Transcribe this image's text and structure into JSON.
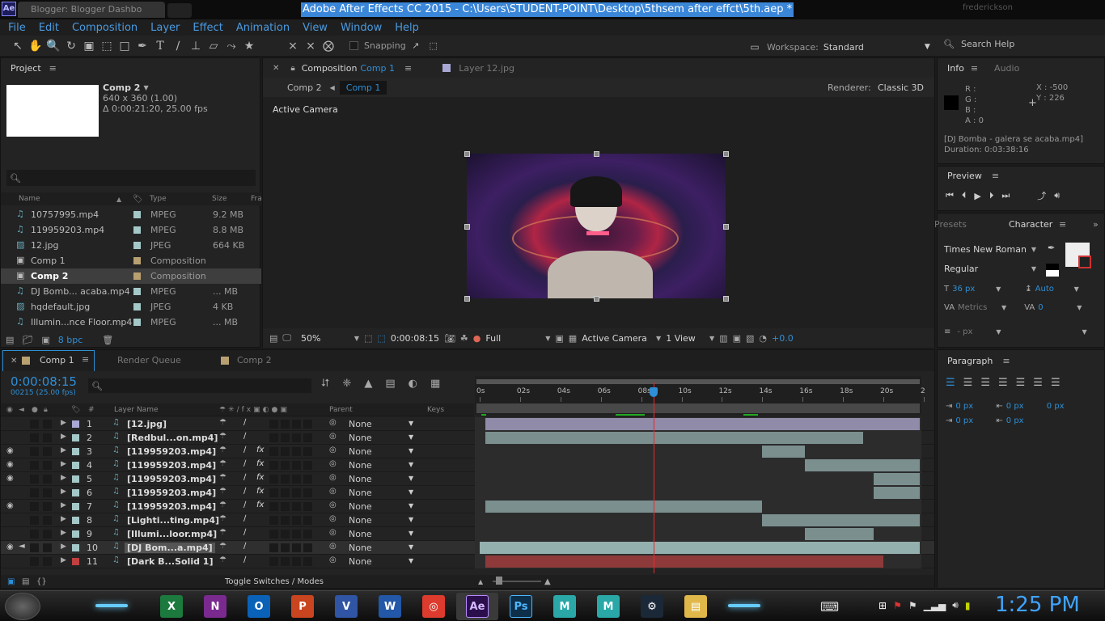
{
  "window": {
    "title": "Adobe After Effects CC 2015 - C:\\Users\\STUDENT-POINT\\Desktop\\5thsem after effct\\5th.aep *",
    "browser_tab": "Blogger: Blogger Dashbo",
    "browser_user": "frederickson",
    "app_badge": "Ae"
  },
  "menu": [
    "File",
    "Edit",
    "Composition",
    "Layer",
    "Effect",
    "Animation",
    "View",
    "Window",
    "Help"
  ],
  "toolbar": {
    "snapping_label": "Snapping",
    "workspace_label": "Workspace:",
    "workspace_value": "Standard",
    "search_help": "Search Help"
  },
  "project": {
    "title": "Project",
    "comp_name": "Comp 2",
    "comp_size": "640 x 360 (1.00)",
    "comp_duration": "Δ 0:00:21:20, 25.00 fps",
    "columns": {
      "name": "Name",
      "type": "Type",
      "size": "Size",
      "fr": "Fra"
    },
    "items": [
      {
        "name": "10757995.mp4",
        "type": "MPEG",
        "size": "9.2 MB",
        "color": "#a4c8c8",
        "kind": "video"
      },
      {
        "name": "119959203.mp4",
        "type": "MPEG",
        "size": "8.8 MB",
        "color": "#a4c8c8",
        "kind": "video"
      },
      {
        "name": "12.jpg",
        "type": "JPEG",
        "size": "664 KB",
        "color": "#a4c8c8",
        "kind": "image"
      },
      {
        "name": "Comp 1",
        "type": "Composition",
        "size": "",
        "color": "#b8a070",
        "kind": "comp"
      },
      {
        "name": "Comp 2",
        "type": "Composition",
        "size": "",
        "color": "#b8a070",
        "kind": "comp"
      },
      {
        "name": "DJ Bomb... acaba.mp4",
        "type": "MPEG",
        "size": "... MB",
        "color": "#a4c8c8",
        "kind": "video"
      },
      {
        "name": "hqdefault.jpg",
        "type": "JPEG",
        "size": "4 KB",
        "color": "#a4c8c8",
        "kind": "image"
      },
      {
        "name": "Illumin...nce Floor.mp4",
        "type": "MPEG",
        "size": "... MB",
        "color": "#a4c8c8",
        "kind": "video"
      }
    ],
    "bpc": "8 bpc"
  },
  "comp_panel": {
    "tab_label": "Composition",
    "tab_comp": "Comp 1",
    "tab2_label": "Layer 12.jpg",
    "breadcrumb1": "Comp 2",
    "breadcrumb2": "Comp 1",
    "renderer_label": "Renderer:",
    "renderer_value": "Classic 3D",
    "view_label": "Active Camera",
    "footer": {
      "zoom": "50%",
      "timecode": "0:00:08:15",
      "resolution": "Full",
      "camera": "Active Camera",
      "views": "1 View",
      "exposure": "+0.0"
    }
  },
  "info": {
    "tab1": "Info",
    "tab2": "Audio",
    "r": "R :",
    "g": "G :",
    "b": "B :",
    "a": "A : 0",
    "x": "X : -500",
    "y": "Y : 226",
    "file": "[DJ Bomba - galera se acaba.mp4]",
    "duration": "Duration: 0:03:38:16"
  },
  "preview": {
    "title": "Preview"
  },
  "character": {
    "tab1": "Presets",
    "tab2": "Character",
    "font": "Times New Roman",
    "style": "Regular",
    "size": "36 px",
    "leading": "Auto",
    "kerning": "Metrics",
    "tracking": "0",
    "stroke": "- px"
  },
  "paragraph": {
    "title": "Paragraph",
    "indent_left": "0 px",
    "indent_first": "0 px",
    "indent_right": "0 px",
    "space_before": "0 px",
    "space_after": "0 px"
  },
  "timeline": {
    "tabs": [
      "Comp 1",
      "Render Queue",
      "Comp 2"
    ],
    "timecode": "0:00:08:15",
    "frames": "00215 (25.00 fps)",
    "col_num": "#",
    "col_name": "Layer Name",
    "col_parent": "Parent",
    "col_keys": "Keys",
    "ruler": [
      "0s",
      "02s",
      "04s",
      "06s",
      "08s",
      "10s",
      "12s",
      "14s",
      "16s",
      "18s",
      "20s",
      "2"
    ],
    "toggle_label": "Toggle Switches / Modes",
    "current_time_seconds": 8.6,
    "total_seconds": 21.8,
    "layers": [
      {
        "num": "1",
        "name": "[12.jpg]",
        "parent": "None",
        "label": "#a9a7d4",
        "eye": false,
        "audio": false,
        "fx": false,
        "bar_start": 0.3,
        "bar_end": 21.8,
        "bar_color": "#8f8ba8"
      },
      {
        "num": "2",
        "name": "[Redbul...on.mp4]",
        "parent": "None",
        "label": "#a4c8c8",
        "eye": false,
        "audio": false,
        "fx": false,
        "bar_start": 0.3,
        "bar_end": 19,
        "bar_color": "#7b8f8f"
      },
      {
        "num": "3",
        "name": "[119959203.mp4]",
        "parent": "None",
        "label": "#a4c8c8",
        "eye": true,
        "audio": false,
        "fx": true,
        "bar_start": 14,
        "bar_end": 16.1,
        "bar_color": "#7b8f8f"
      },
      {
        "num": "4",
        "name": "[119959203.mp4]",
        "parent": "None",
        "label": "#a4c8c8",
        "eye": true,
        "audio": false,
        "fx": true,
        "bar_start": 16.1,
        "bar_end": 21.8,
        "bar_color": "#7b8f8f"
      },
      {
        "num": "5",
        "name": "[119959203.mp4]",
        "parent": "None",
        "label": "#a4c8c8",
        "eye": true,
        "audio": false,
        "fx": true,
        "bar_start": 19.5,
        "bar_end": 21.8,
        "bar_color": "#7b8f8f"
      },
      {
        "num": "6",
        "name": "[119959203.mp4]",
        "parent": "None",
        "label": "#a4c8c8",
        "eye": false,
        "audio": false,
        "fx": true,
        "bar_start": 19.5,
        "bar_end": 21.8,
        "bar_color": "#7b8f8f"
      },
      {
        "num": "7",
        "name": "[119959203.mp4]",
        "parent": "None",
        "label": "#a4c8c8",
        "eye": true,
        "audio": false,
        "fx": true,
        "bar_start": 0.3,
        "bar_end": 14,
        "bar_color": "#7b8f8f"
      },
      {
        "num": "8",
        "name": "[Lighti...ting.mp4]",
        "parent": "None",
        "label": "#a4c8c8",
        "eye": false,
        "audio": false,
        "fx": false,
        "bar_start": 14,
        "bar_end": 21.8,
        "bar_color": "#7b8f8f"
      },
      {
        "num": "9",
        "name": "[Illumi...loor.mp4]",
        "parent": "None",
        "label": "#a4c8c8",
        "eye": false,
        "audio": false,
        "fx": false,
        "bar_start": 16.1,
        "bar_end": 19.5,
        "bar_color": "#7b8f8f"
      },
      {
        "num": "10",
        "name": "[DJ Bom...a.mp4]",
        "parent": "None",
        "label": "#a4c8c8",
        "eye": true,
        "audio": true,
        "fx": false,
        "bar_start": 0,
        "bar_end": 21.8,
        "bar_color": "#93b0ae"
      },
      {
        "num": "11",
        "name": "[Dark B...Solid 1]",
        "parent": "None",
        "label": "#c04040",
        "eye": false,
        "audio": false,
        "fx": false,
        "bar_start": 0.3,
        "bar_end": 20,
        "bar_color": "#8e3a3a"
      }
    ]
  },
  "taskbar": {
    "clock": "1:25 PM",
    "apps": [
      "Excel",
      "OneNote",
      "Outlook",
      "PowerPoint",
      "Visio",
      "Word",
      "Chrome",
      "After Effects",
      "Photoshop",
      "Maya",
      "Maya",
      "Steam",
      "File Explorer"
    ]
  }
}
